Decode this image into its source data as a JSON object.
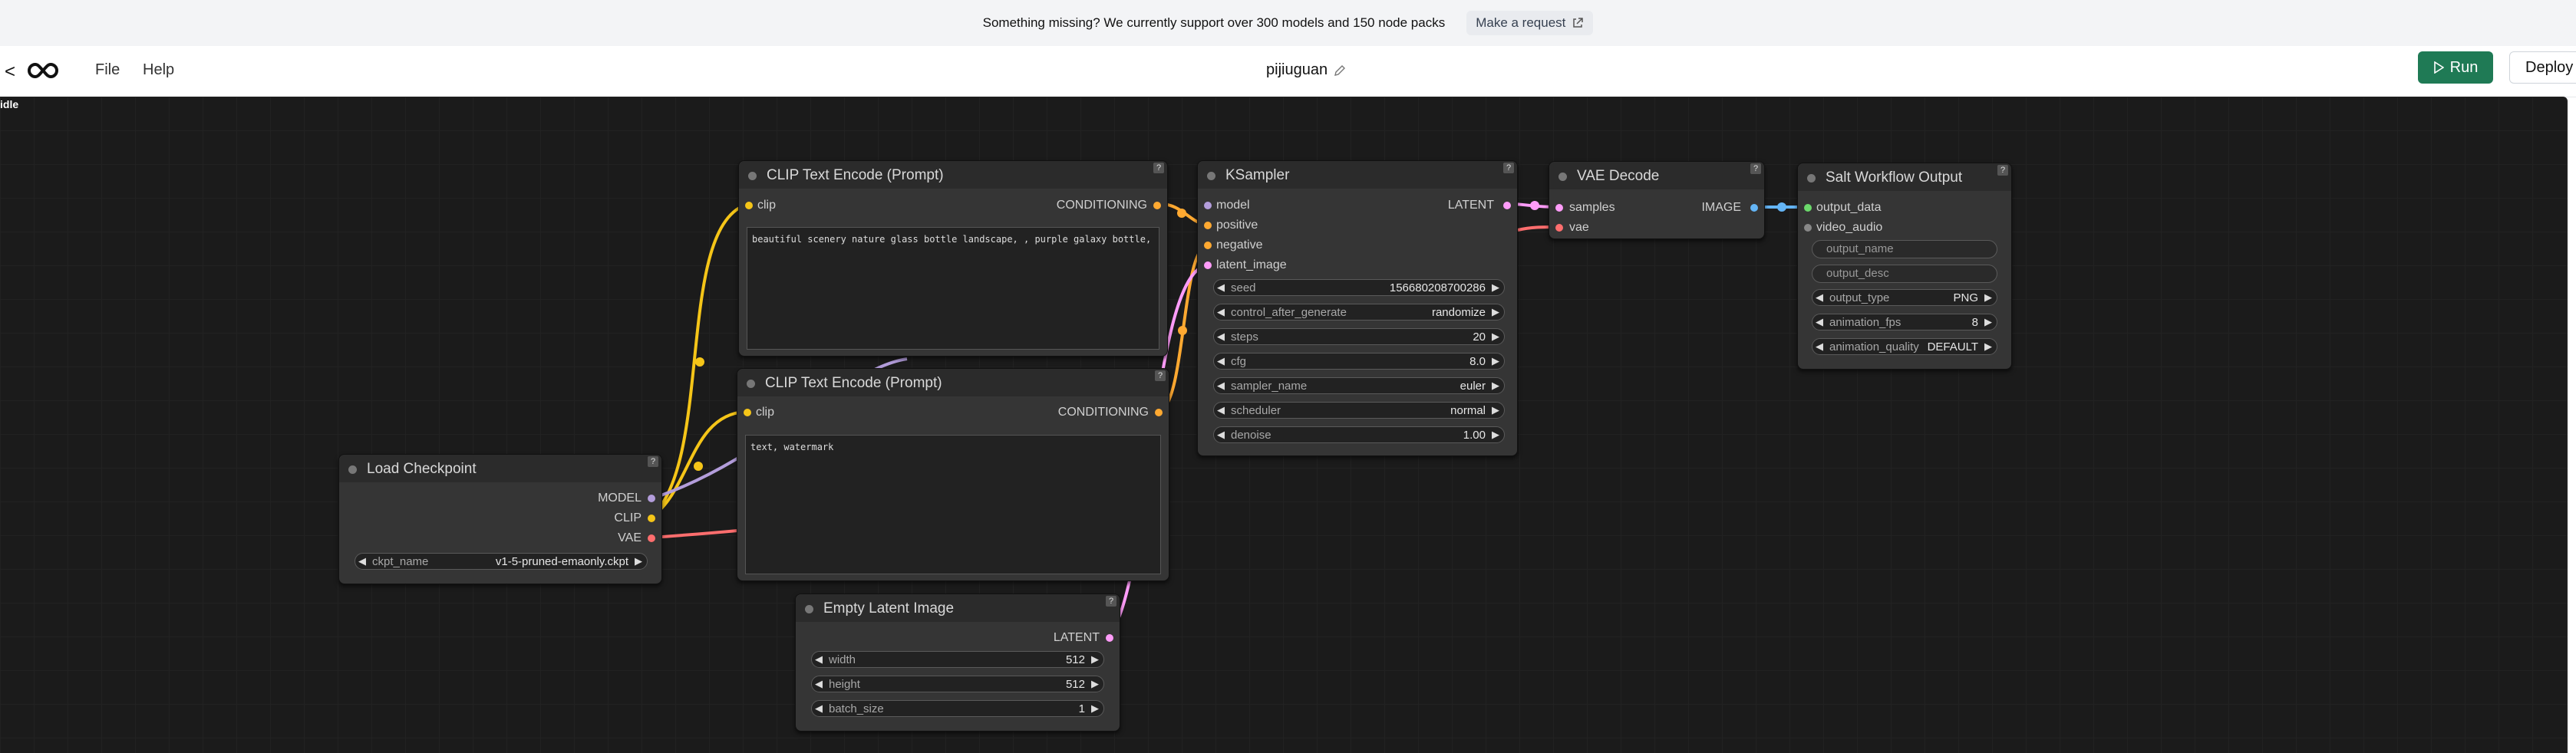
{
  "banner": {
    "message": "Something missing? We currently support over 300 models and 150 node packs",
    "request_label": "Make a request"
  },
  "header": {
    "back": "<",
    "menu_file": "File",
    "menu_help": "Help",
    "title": "pijiuguan",
    "run_label": "Run",
    "deploy_label": "Deploy"
  },
  "status": "idle",
  "nodes": {
    "clip1": {
      "title": "CLIP Text Encode (Prompt)",
      "in_clip": "clip",
      "out": "CONDITIONING",
      "text": "beautiful scenery nature glass bottle landscape, , purple galaxy bottle,"
    },
    "clip2": {
      "title": "CLIP Text Encode (Prompt)",
      "in_clip": "clip",
      "out": "CONDITIONING",
      "text": "text, watermark"
    },
    "checkpoint": {
      "title": "Load Checkpoint",
      "out_model": "MODEL",
      "out_clip": "CLIP",
      "out_vae": "VAE",
      "w_name": "ckpt_name",
      "w_value": "v1-5-pruned-emaonly.ckpt"
    },
    "latent": {
      "title": "Empty Latent Image",
      "out": "LATENT",
      "widgets": [
        {
          "name": "width",
          "value": "512"
        },
        {
          "name": "height",
          "value": "512"
        },
        {
          "name": "batch_size",
          "value": "1"
        }
      ]
    },
    "ksampler": {
      "title": "KSampler",
      "in_model": "model",
      "in_positive": "positive",
      "in_negative": "negative",
      "in_latent": "latent_image",
      "out": "LATENT",
      "widgets": [
        {
          "name": "seed",
          "value": "156680208700286"
        },
        {
          "name": "control_after_generate",
          "value": "randomize"
        },
        {
          "name": "steps",
          "value": "20"
        },
        {
          "name": "cfg",
          "value": "8.0"
        },
        {
          "name": "sampler_name",
          "value": "euler"
        },
        {
          "name": "scheduler",
          "value": "normal"
        },
        {
          "name": "denoise",
          "value": "1.00"
        }
      ]
    },
    "vae": {
      "title": "VAE Decode",
      "in_samples": "samples",
      "in_vae": "vae",
      "out": "IMAGE"
    },
    "salt": {
      "title": "Salt Workflow Output",
      "in_output_data": "output_data",
      "in_video_audio": "video_audio",
      "text_output_name": "output_name",
      "text_output_desc": "output_desc",
      "widgets": [
        {
          "name": "output_type",
          "value": "PNG"
        },
        {
          "name": "animation_fps",
          "value": "8"
        },
        {
          "name": "animation_quality",
          "value": "DEFAULT"
        }
      ]
    }
  },
  "colors": {
    "clip": "#f5c518",
    "model": "#b39ddb",
    "vae": "#ff6e6e",
    "latent": "#ff9cf9",
    "conditioning": "#ffa931",
    "image": "#64b5f6",
    "run": "#1f7a55"
  }
}
